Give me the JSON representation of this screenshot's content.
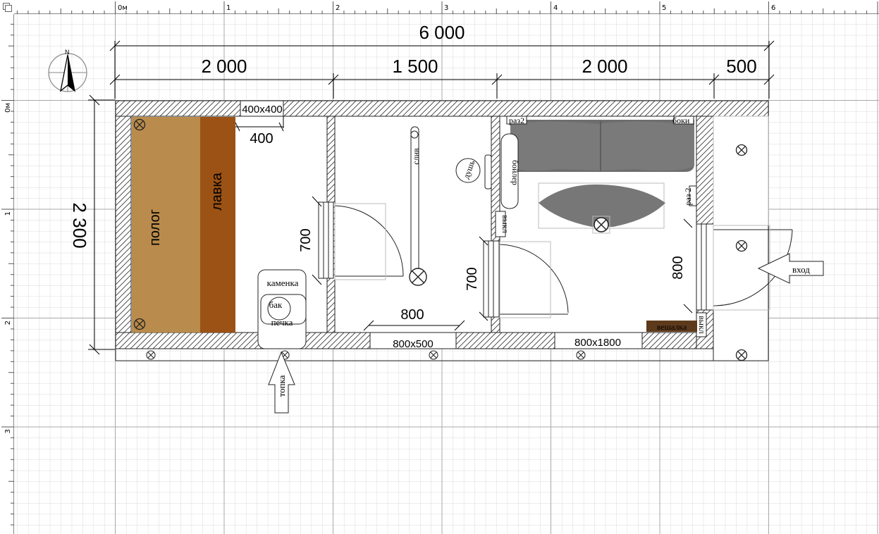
{
  "ruler": {
    "top_marks": [
      "0м",
      "1",
      "2",
      "3",
      "4",
      "5",
      "6"
    ],
    "left_marks": [
      "0м",
      "1",
      "2",
      "3"
    ]
  },
  "dimensions": {
    "total_width": "6 000",
    "segment_1": "2 000",
    "segment_2": "1 500",
    "segment_3": "2 000",
    "segment_4": "500",
    "total_height": "2 300",
    "opening_400x400": "400x400",
    "width_400": "400",
    "door_sauna": "700",
    "door_wash": "700",
    "door_entry": "800",
    "width_800": "800",
    "window_wash": "800x500",
    "window_rest": "800x1800"
  },
  "labels": {
    "polog": "полог",
    "lavka": "лавка",
    "kamenka": "каменка",
    "bak": "бак",
    "pechka": "печка",
    "sliv": "слив",
    "dush": "душь",
    "boiler": "бойлер",
    "vykl_1": "выкл",
    "vykl_2": "выкл",
    "raz_1": "раз2",
    "raz_2": "раз 2",
    "boki": "боки",
    "veshalka": "вешалка",
    "vhod": "вход",
    "topka": "топка"
  },
  "colors": {
    "polog": "#b98b4c",
    "lavka": "#9b5214",
    "sofa": "#6e6e6e",
    "table": "#777777",
    "veshalka": "#5e3a1c",
    "grid_minor": "#dadada",
    "grid_major": "#a8a8a8"
  },
  "icons": {
    "compass": "compass-north-icon",
    "light": "light-fixture-icon",
    "drain": "drain-icon"
  }
}
